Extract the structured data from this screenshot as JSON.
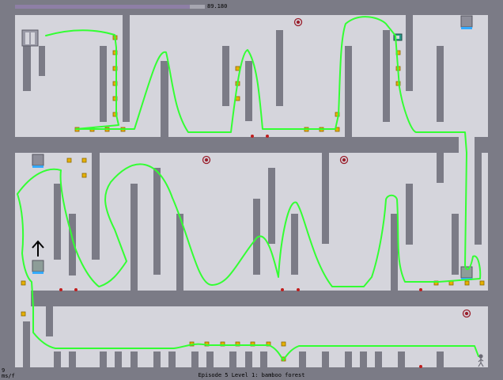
{
  "hud": {
    "time_remaining": "89.180",
    "time_fraction": 0.92,
    "fps": "9",
    "fps_unit": "ms/f",
    "level_title": "Episode 5 Level 1: bamboo forest"
  },
  "colors": {
    "wall": "#7b7b86",
    "floor": "#d5d5dc",
    "pillar": "#7b7b86",
    "path": "#33ff33",
    "gold": "#e6b000",
    "mine": "#c01e1e",
    "door": "#8d8d98"
  },
  "icons": [
    "exit-door-icon",
    "exit-switch-icon",
    "gold-icon",
    "mine-icon",
    "drone-icon",
    "ninja-icon",
    "launchpad-icon",
    "up-arrow-icon"
  ]
}
